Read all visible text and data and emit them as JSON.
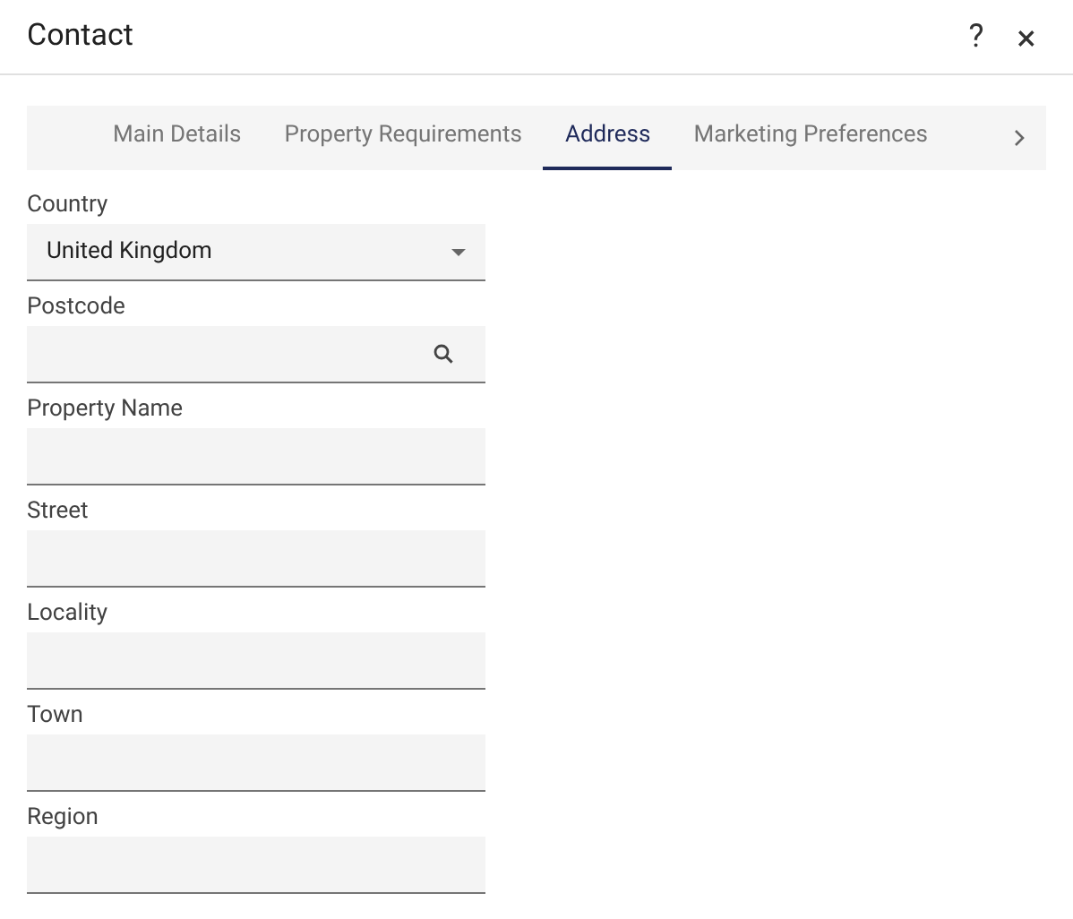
{
  "window": {
    "title": "Contact",
    "help": "?",
    "close": "×"
  },
  "tabs": [
    {
      "label": "Main Details",
      "selected": false
    },
    {
      "label": "Property Requirements",
      "selected": false
    },
    {
      "label": "Address",
      "selected": true
    },
    {
      "label": "Marketing Preferences",
      "selected": false
    }
  ],
  "fields": [
    {
      "label": "Country",
      "kind": "select",
      "value": "United Kingdom"
    },
    {
      "label": "Postcode",
      "kind": "search"
    },
    {
      "label": "Property Name",
      "kind": "text"
    },
    {
      "label": "Street",
      "kind": "text"
    },
    {
      "label": "Locality",
      "kind": "text"
    },
    {
      "label": "Town",
      "kind": "text"
    },
    {
      "label": "Region",
      "kind": "text"
    }
  ]
}
